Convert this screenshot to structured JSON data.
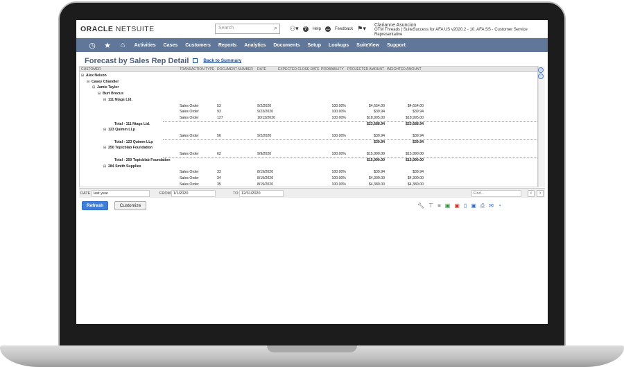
{
  "app": {
    "logo_bold": "ORACLE",
    "logo_rest": " NETSUITE",
    "search_placeholder": "Search",
    "help": "Help",
    "feedback": "Feedback",
    "user_name": "Clarianne Asuncion",
    "user_role": "OTM Threads | SuiteSuccess for AFA US v2020.2 - 10. AFA SS - Customer Service Representative"
  },
  "nav": [
    "Activities",
    "Cases",
    "Customers",
    "Reports",
    "Analytics",
    "Documents",
    "Setup",
    "Lookups",
    "SuiteView",
    "Support"
  ],
  "page": {
    "title": "Forecast by Sales Rep Detail",
    "back_link": "Back to Summary"
  },
  "columns": [
    "CUSTOMER",
    "TRANSACTION TYPE",
    "DOCUMENT NUMBER",
    "DATE",
    "EXPECTED CLOSE DATE",
    "PROBABILITY",
    "PROJECTED AMOUNT",
    "WEIGHTED AMOUNT"
  ],
  "rows": [
    {
      "indent": 0,
      "customer": "Alex Nelson",
      "group": true
    },
    {
      "indent": 1,
      "customer": "Casey Chandler",
      "group": true
    },
    {
      "indent": 2,
      "customer": "Jamie Taylor",
      "group": true
    },
    {
      "indent": 3,
      "customer": "Burt Brocus",
      "group": true
    },
    {
      "indent": 4,
      "customer": "111 Ntags Ltd.",
      "group": true
    },
    {
      "type": "Sales Order",
      "doc": "53",
      "date": "9/2/2020",
      "prob": "100.00%",
      "proj": "$4,654.00",
      "weighted": "$4,654.00"
    },
    {
      "type": "Sales Order",
      "doc": "93",
      "date": "9/23/2020",
      "prob": "100.00%",
      "proj": "$39.94",
      "weighted": "$39.94"
    },
    {
      "type": "Sales Order",
      "doc": "127",
      "date": "10/13/2020",
      "prob": "100.00%",
      "proj": "$18,995.00",
      "weighted": "$18,995.00"
    },
    {
      "total": true,
      "customer": "Total - 111 Ntags Ltd.",
      "proj": "$23,688.94",
      "weighted": "$23,688.94"
    },
    {
      "indent": 4,
      "customer": "123 Quimm LLp",
      "group": true
    },
    {
      "type": "Sales Order",
      "doc": "56",
      "date": "9/2/2020",
      "prob": "100.00%",
      "proj": "$39.94",
      "weighted": "$39.94"
    },
    {
      "total": true,
      "customer": "Total - 123 Quimm LLp",
      "proj": "$39.94",
      "weighted": "$39.94"
    },
    {
      "indent": 4,
      "customer": "250 Topicblab Foundation",
      "group": true
    },
    {
      "type": "Sales Order",
      "doc": "62",
      "date": "9/9/2020",
      "prob": "100.00%",
      "proj": "$15,990.00",
      "weighted": "$15,990.00"
    },
    {
      "total": true,
      "customer": "Total - 250 Topicblab Foundation",
      "proj": "$15,990.00",
      "weighted": "$15,990.00"
    },
    {
      "indent": 4,
      "customer": "284 Smith Supplies",
      "group": true
    },
    {
      "type": "Sales Order",
      "doc": "33",
      "date": "8/19/2020",
      "prob": "100.00%",
      "proj": "$39.94",
      "weighted": "$39.94"
    },
    {
      "type": "Sales Order",
      "doc": "34",
      "date": "8/19/2020",
      "prob": "100.00%",
      "proj": "$4,300.00",
      "weighted": "$4,300.00"
    },
    {
      "type": "Sales Order",
      "doc": "35",
      "date": "8/19/2020",
      "prob": "100.00%",
      "proj": "$4,380.00",
      "weighted": "$4,380.00"
    }
  ],
  "filters": {
    "date_label": "DATE",
    "date_value": "last year",
    "from_label": "FROM",
    "from_value": "1/1/2020",
    "to_label": "TO",
    "to_value": "12/31/2020",
    "find_placeholder": "Find..."
  },
  "buttons": {
    "refresh": "Refresh",
    "customize": "Customize"
  }
}
